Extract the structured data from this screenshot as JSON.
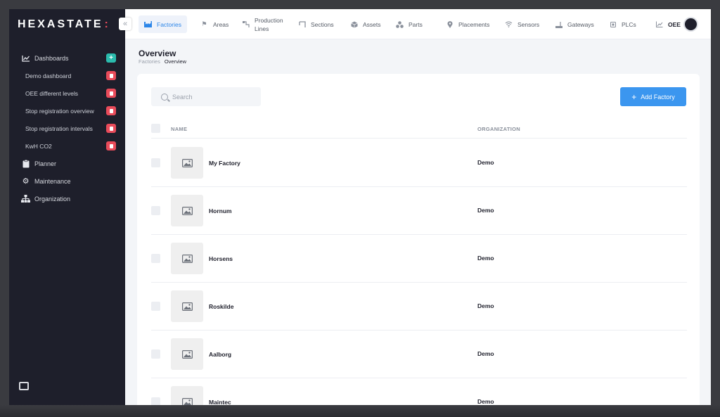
{
  "brand": {
    "name": "HEXASTATE",
    "suffix": ":"
  },
  "sidebar": {
    "collapse_glyph": "«",
    "items": [
      {
        "label": "Dashboards",
        "icon": "chart-line-icon",
        "action": "+"
      },
      {
        "label": "Demo dashboard",
        "sub": true
      },
      {
        "label": "OEE different levels",
        "sub": true
      },
      {
        "label": "Stop registration overview",
        "sub": true
      },
      {
        "label": "Stop registration intervals",
        "sub": true
      },
      {
        "label": "KwH CO2",
        "sub": true
      },
      {
        "label": "Planner",
        "icon": "clipboard-icon"
      },
      {
        "label": "Maintenance",
        "icon": "gear-icon"
      },
      {
        "label": "Organization",
        "icon": "org-chart-icon"
      }
    ]
  },
  "topnav": {
    "tabs": [
      {
        "label": "Factories",
        "icon": "factory-icon",
        "active": true
      },
      {
        "label": "Areas",
        "icon": "flag-icon"
      },
      {
        "label": "Production Lines",
        "icon": "production-line-icon"
      },
      {
        "label": "Sections",
        "icon": "section-icon"
      },
      {
        "label": "Assets",
        "icon": "cube-icon"
      },
      {
        "label": "Parts",
        "icon": "parts-icon"
      },
      {
        "label": "Placements",
        "icon": "pin-icon"
      },
      {
        "label": "Sensors",
        "icon": "wifi-icon"
      },
      {
        "label": "Gateways",
        "icon": "gateway-icon"
      },
      {
        "label": "PLCs",
        "icon": "chip-icon"
      },
      {
        "label": "OEE",
        "icon": "chart-icon"
      }
    ]
  },
  "page": {
    "title": "Overview",
    "breadcrumb": {
      "parent": "Factories",
      "current": "Overview"
    }
  },
  "search": {
    "placeholder": "Search"
  },
  "add_button": {
    "label": "Add Factory",
    "icon": "+"
  },
  "table": {
    "columns": {
      "name": "NAME",
      "organization": "ORGANIZATION"
    },
    "rows": [
      {
        "name": "My Factory",
        "organization": "Demo"
      },
      {
        "name": "Hornum",
        "organization": "Demo"
      },
      {
        "name": "Horsens",
        "organization": "Demo"
      },
      {
        "name": "Roskilde",
        "organization": "Demo"
      },
      {
        "name": "Aalborg",
        "organization": "Demo"
      },
      {
        "name": "Maintec",
        "organization": "Demo"
      }
    ]
  },
  "colors": {
    "accent": "#3b96ef",
    "sidebar_bg": "#1e1f2b",
    "add_badge": "#2bbbad",
    "delete_badge": "#e94b5a"
  }
}
